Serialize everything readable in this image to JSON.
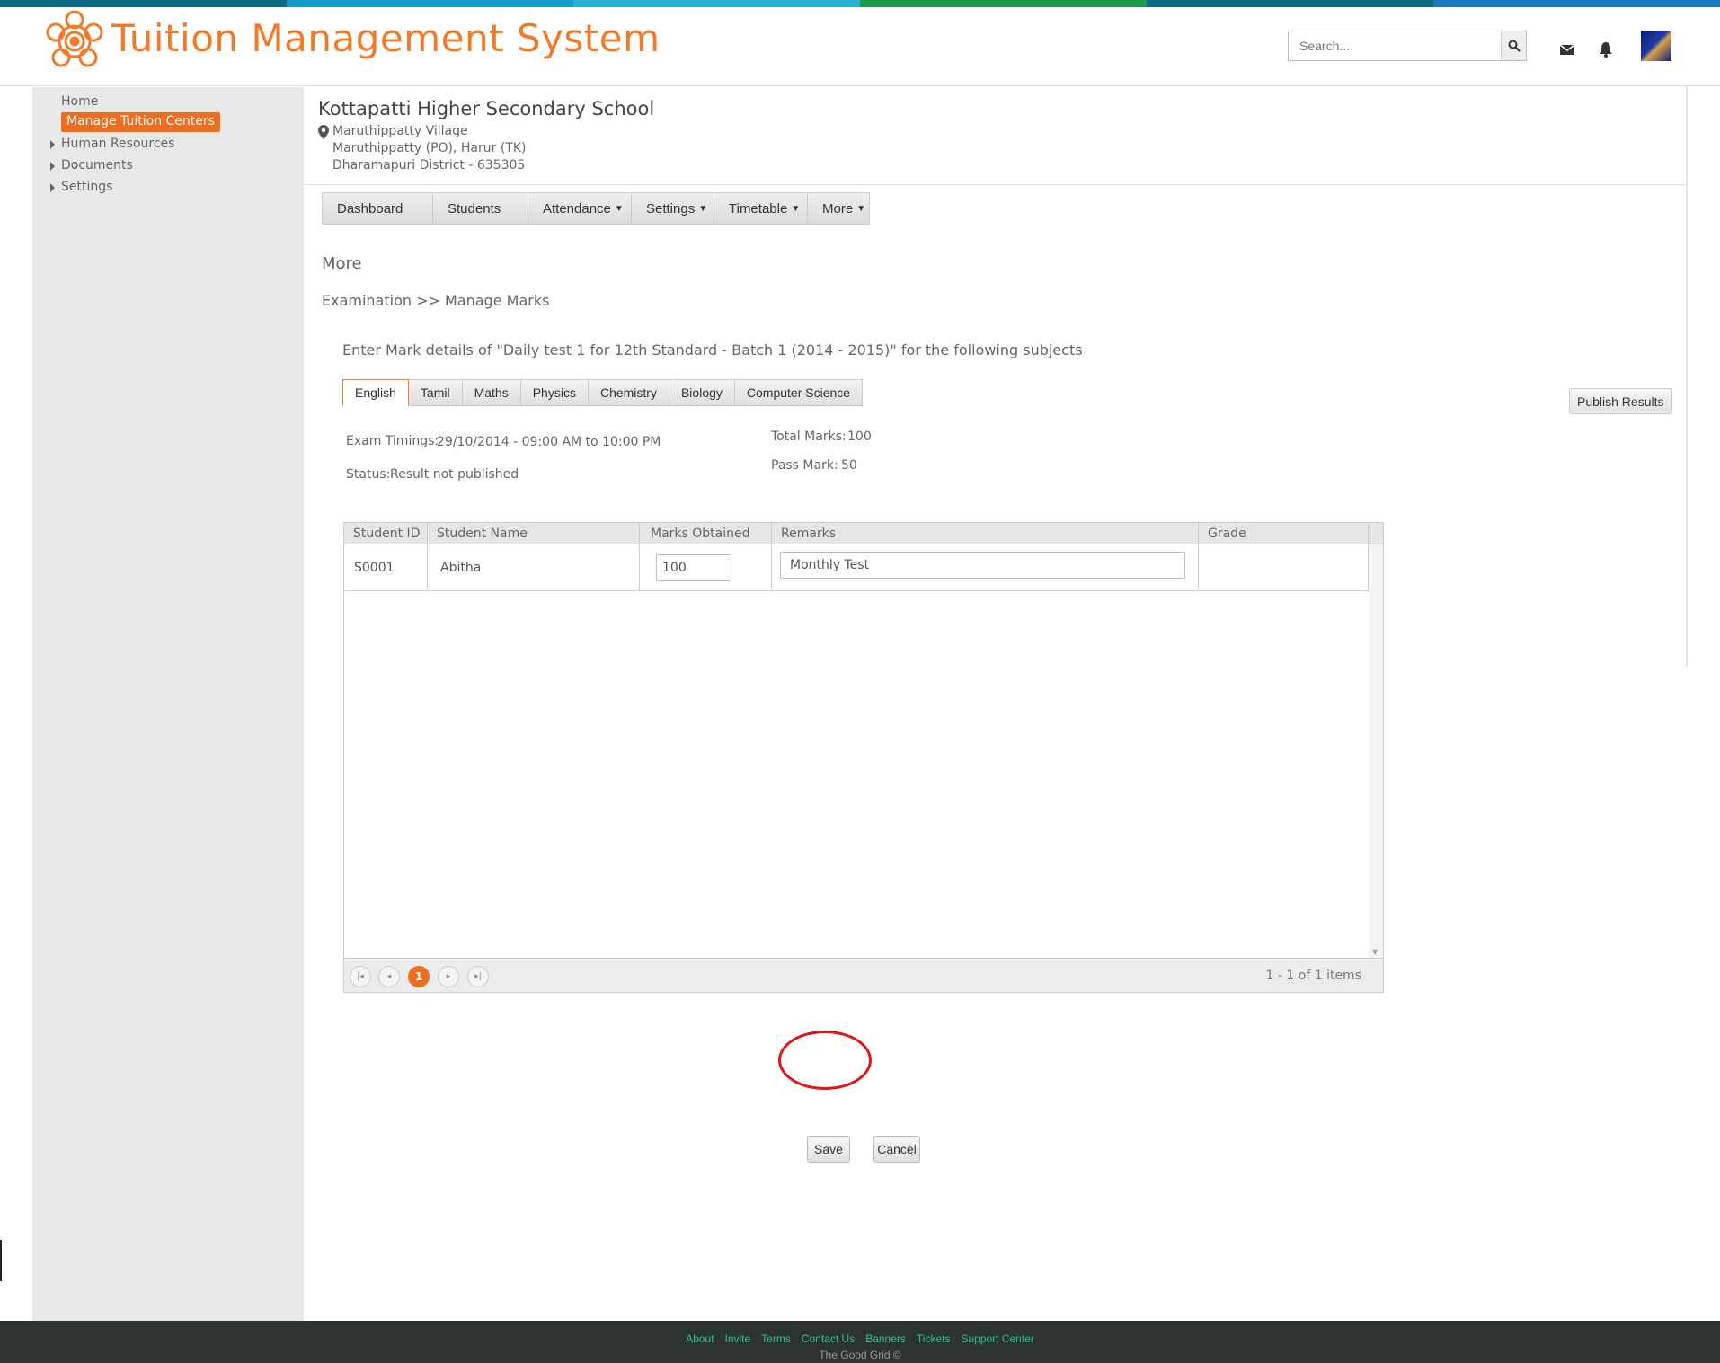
{
  "header": {
    "app_title": "Tuition Management System",
    "search_placeholder": "Search...",
    "stripe_colors": [
      "#0b6a86",
      "#1a9ac9",
      "#2bb0d0",
      "#1a9a4a",
      "#0b6a86",
      "#1a7ac0"
    ],
    "accent": "#f07b2a"
  },
  "sidebar": {
    "items": [
      {
        "label": "Home",
        "icon": ""
      },
      {
        "label": "Manage Tuition  Centers",
        "active": true
      },
      {
        "label": "Human Resources",
        "icon": "caret-right-icon"
      },
      {
        "label": "Documents",
        "icon": "caret-right-icon"
      },
      {
        "label": "Settings",
        "icon": "caret-right-icon"
      }
    ]
  },
  "school": {
    "name": "Kottapatti Higher Secondary School",
    "address": [
      "Maruthippatty Village",
      "Maruthippatty (PO), Harur (TK)",
      "Dharamapuri District - 635305"
    ]
  },
  "nav": [
    {
      "label": "Dashboard"
    },
    {
      "label": "Students"
    },
    {
      "label": "Attendance",
      "dropdown": true
    },
    {
      "label": "Settings",
      "dropdown": true
    },
    {
      "label": "Timetable",
      "dropdown": true
    },
    {
      "label": "More",
      "dropdown": true
    }
  ],
  "section_title": "More",
  "breadcrumb": "Examination >> Manage Marks",
  "instruction": "Enter Mark details of \"Daily test 1 for 12th Standard - Batch 1 (2014 - 2015)\" for the following subjects",
  "subject_tabs": [
    "English",
    "Tamil",
    "Maths",
    "Physics",
    "Chemistry",
    "Biology",
    "Computer Science"
  ],
  "active_tab": "English",
  "publish_label": "Publish Results",
  "exam": {
    "timings_label": "Exam Timings:",
    "timings_value": "29/10/2014 - 09:00 AM to 10:00 PM",
    "status_label": "Status:",
    "status_value": "Result not published",
    "total_label": "Total Marks:",
    "total_value": "100",
    "pass_label": "Pass Mark:",
    "pass_value": "50"
  },
  "grid": {
    "columns": [
      "Student ID",
      "Student Name",
      "Marks Obtained",
      "Remarks",
      "Grade"
    ],
    "rows": [
      {
        "id": "S0001",
        "name": "Abitha",
        "marks": "100",
        "remarks": "Monthly Test",
        "grade": ""
      }
    ],
    "pager": {
      "current": "1",
      "info": "1 - 1 of 1 items"
    }
  },
  "actions": {
    "save": "Save",
    "cancel": "Cancel"
  },
  "footer": {
    "links": [
      "About",
      "Invite",
      "Terms",
      "Contact Us",
      "Banners",
      "Tickets",
      "Support Center"
    ],
    "copyright": "The Good Grid ©"
  }
}
